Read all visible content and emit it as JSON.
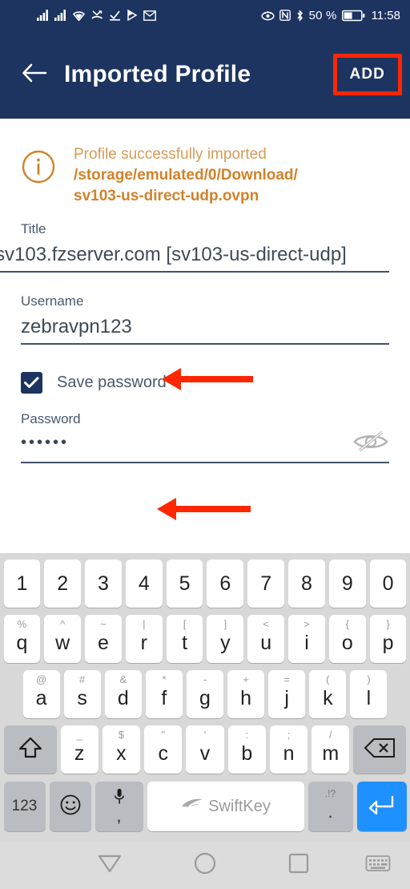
{
  "status_bar": {
    "battery_percent": "50 %",
    "time": "11:58",
    "left_icons": [
      "signal-bars-icon",
      "signal-bars-2-icon",
      "wifi-icon",
      "missed-call-icon",
      "download-complete-icon",
      "play-store-icon",
      "gmail-icon"
    ],
    "right_icons": [
      "eye-comfort-icon",
      "nfc-icon",
      "bluetooth-icon",
      "battery-icon"
    ]
  },
  "app_bar": {
    "back_label": "back-arrow",
    "title": "Imported Profile",
    "add_label": "ADD",
    "highlight_color": "#ff2600",
    "background_color": "#1d3461"
  },
  "notice": {
    "icon": "info-circle-icon",
    "line1": "Profile successfully imported",
    "path_line1": "/storage/emulated/0/Download/",
    "path_line2": "sv103-us-direct-udp.ovpn",
    "color": "#d2822a"
  },
  "form": {
    "title": {
      "label": "Title",
      "value": "sv103.fzserver.com [sv103-us-direct-udp]"
    },
    "username": {
      "label": "Username",
      "value": "zebravpn123"
    },
    "save_password": {
      "label": "Save password",
      "checked": true
    },
    "password": {
      "label": "Password",
      "value": "••••••",
      "toggle_icon": "eye-off-icon"
    }
  },
  "annotations": {
    "arrow_color": "#ff2600",
    "arrows": [
      "username-arrow",
      "password-arrow"
    ]
  },
  "keyboard": {
    "app_name": "SwiftKey",
    "rows": [
      {
        "name": "number-row",
        "keys": [
          {
            "main": "1"
          },
          {
            "main": "2"
          },
          {
            "main": "3"
          },
          {
            "main": "4"
          },
          {
            "main": "5"
          },
          {
            "main": "6"
          },
          {
            "main": "7"
          },
          {
            "main": "8"
          },
          {
            "main": "9"
          },
          {
            "main": "0"
          }
        ]
      },
      {
        "name": "qwerty-row",
        "keys": [
          {
            "main": "q",
            "sub": "%"
          },
          {
            "main": "w",
            "sub": "^"
          },
          {
            "main": "e",
            "sub": "~"
          },
          {
            "main": "r",
            "sub": "|"
          },
          {
            "main": "t",
            "sub": "["
          },
          {
            "main": "y",
            "sub": "]"
          },
          {
            "main": "u",
            "sub": "<"
          },
          {
            "main": "i",
            "sub": ">"
          },
          {
            "main": "o",
            "sub": "{"
          },
          {
            "main": "p",
            "sub": "}"
          }
        ]
      },
      {
        "name": "asdf-row",
        "keys": [
          {
            "main": "a",
            "sub": "@"
          },
          {
            "main": "s",
            "sub": "#"
          },
          {
            "main": "d",
            "sub": "&"
          },
          {
            "main": "f",
            "sub": "*"
          },
          {
            "main": "g",
            "sub": "-"
          },
          {
            "main": "h",
            "sub": "+"
          },
          {
            "main": "j",
            "sub": "="
          },
          {
            "main": "k",
            "sub": "("
          },
          {
            "main": "l",
            "sub": ")"
          }
        ]
      },
      {
        "name": "zxcv-row",
        "keys": [
          {
            "main": "z",
            "sub": "_"
          },
          {
            "main": "x",
            "sub": "$"
          },
          {
            "main": "c",
            "sub": "\""
          },
          {
            "main": "v",
            "sub": "'"
          },
          {
            "main": "b",
            "sub": ":"
          },
          {
            "main": "n",
            "sub": ";"
          },
          {
            "main": "m",
            "sub": "/"
          }
        ],
        "shift": "shift-icon",
        "backspace": "backspace-icon"
      }
    ],
    "bottom_row": {
      "numeric_label": "123",
      "emoji_icon": "emoji-smiley-icon",
      "mic_icon": "microphone-icon",
      "mic_sub": ",",
      "space_label": "SwiftKey",
      "period_sub": ".!?",
      "period_main": ".",
      "enter_icon": "enter-icon",
      "enter_color": "#1e90ff"
    }
  },
  "nav_bar": {
    "back": "nav-back-triangle-icon",
    "home": "nav-home-circle-icon",
    "recent": "nav-recent-square-icon",
    "keyboard": "nav-hide-keyboard-icon"
  }
}
